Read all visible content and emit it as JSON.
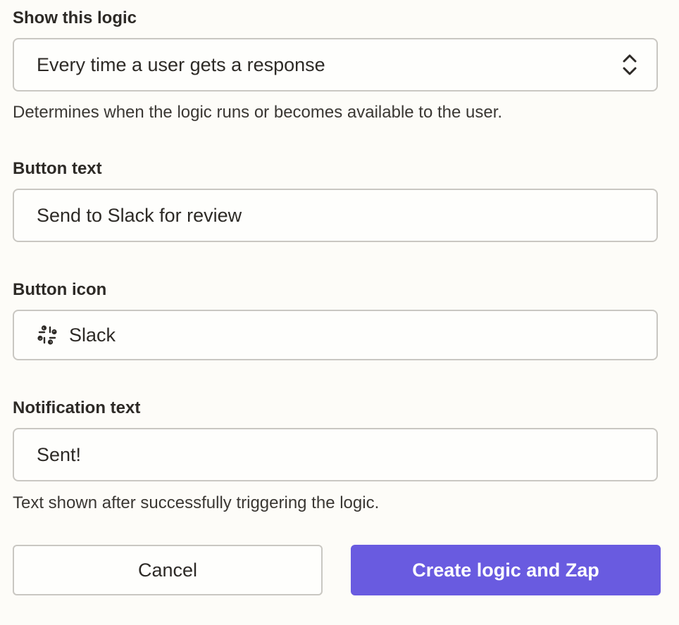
{
  "logic_trigger": {
    "label": "Show this logic",
    "selected_value": "Every time a user gets a response",
    "help_text": "Determines when the logic runs or becomes available to the user."
  },
  "button_text": {
    "label": "Button text",
    "value": "Send to Slack for review"
  },
  "button_icon": {
    "label": "Button icon",
    "value": "Slack",
    "icon": "slack-icon"
  },
  "notification_text": {
    "label": "Notification text",
    "value": "Sent!",
    "help_text": "Text shown after successfully triggering the logic."
  },
  "actions": {
    "cancel_label": "Cancel",
    "submit_label": "Create logic and Zap"
  },
  "colors": {
    "background": "#fdfcf8",
    "border": "#c9c7c2",
    "text": "#2d2a26",
    "primary": "#695be0"
  }
}
